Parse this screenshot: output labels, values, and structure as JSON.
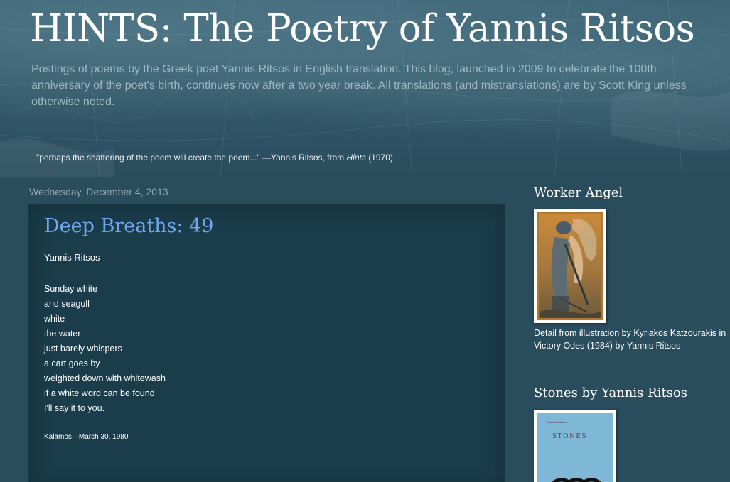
{
  "blog": {
    "title": "HINTS: The Poetry of Yannis Ritsos",
    "description": "Postings of poems by the Greek poet Yannis Ritsos in English translation. This blog, launched in 2009 to celebrate the 100th anniversary of the poet's birth, continues now after a two year break. All translations (and mistranslations) are by Scott King unless otherwise noted.",
    "quote_prefix": "\"perhaps the shattering of the poem will create the poem...\" —Yannis Ritsos, from ",
    "quote_book": "Hints",
    "quote_suffix": " (1970)"
  },
  "post": {
    "date": "Wednesday, December 4, 2013",
    "title": "Deep Breaths: 49",
    "author": "Yannis Ritsos",
    "poem_lines": [
      "Sunday white",
      "and seagull",
      "white",
      "the water",
      "just barely whispers",
      "a cart goes by",
      "weighted down with whitewash",
      "if a white word can be found",
      "I'll say it to you."
    ],
    "place_date": "Kalamos—March 30, 1980"
  },
  "sidebar": {
    "widget1": {
      "title": "Worker Angel",
      "caption": "Detail from illustration by Kyriakos Katzourakis in Victory Odes (1984) by Yannis Ritsos"
    },
    "widget2": {
      "title": "Stones by Yannis Ritsos",
      "cover_author": "Yannis Ritsos",
      "cover_title": "STONES"
    }
  },
  "colors": {
    "background": "#2a4d5e",
    "post_title": "#6fa8ef",
    "description_text": "#9fb6c2",
    "date_text": "#8fa6b2"
  }
}
